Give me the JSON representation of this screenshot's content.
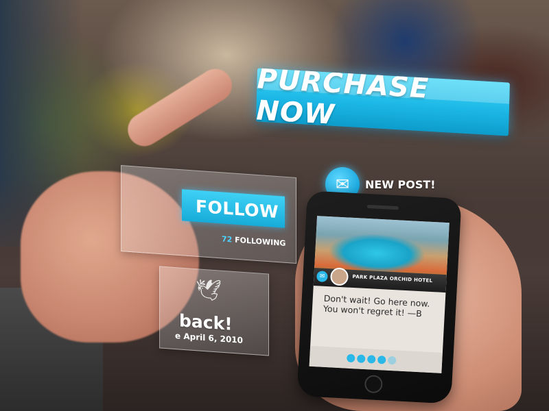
{
  "purchase": {
    "label": "PURCHASE NOW"
  },
  "follow_panel": {
    "button_label": "FOLLOW",
    "following_count": "72",
    "following_label": "FOLLOWING"
  },
  "welcome_panel": {
    "icon": "bird-icon",
    "title": "back!",
    "date": "e April 6, 2010"
  },
  "notification": {
    "icon": "mail-icon",
    "label": "NEW POST!"
  },
  "phone": {
    "hotel_name": "PARK PLAZA ORCHID HOTEL",
    "post_text": "Don't wait! Go here now. You won't regret it! —B",
    "rating": 4,
    "rating_max": 5
  },
  "colors": {
    "accent": "#1cb7e6",
    "accent_light": "#3fd6f7",
    "text_light": "#ffffff"
  }
}
